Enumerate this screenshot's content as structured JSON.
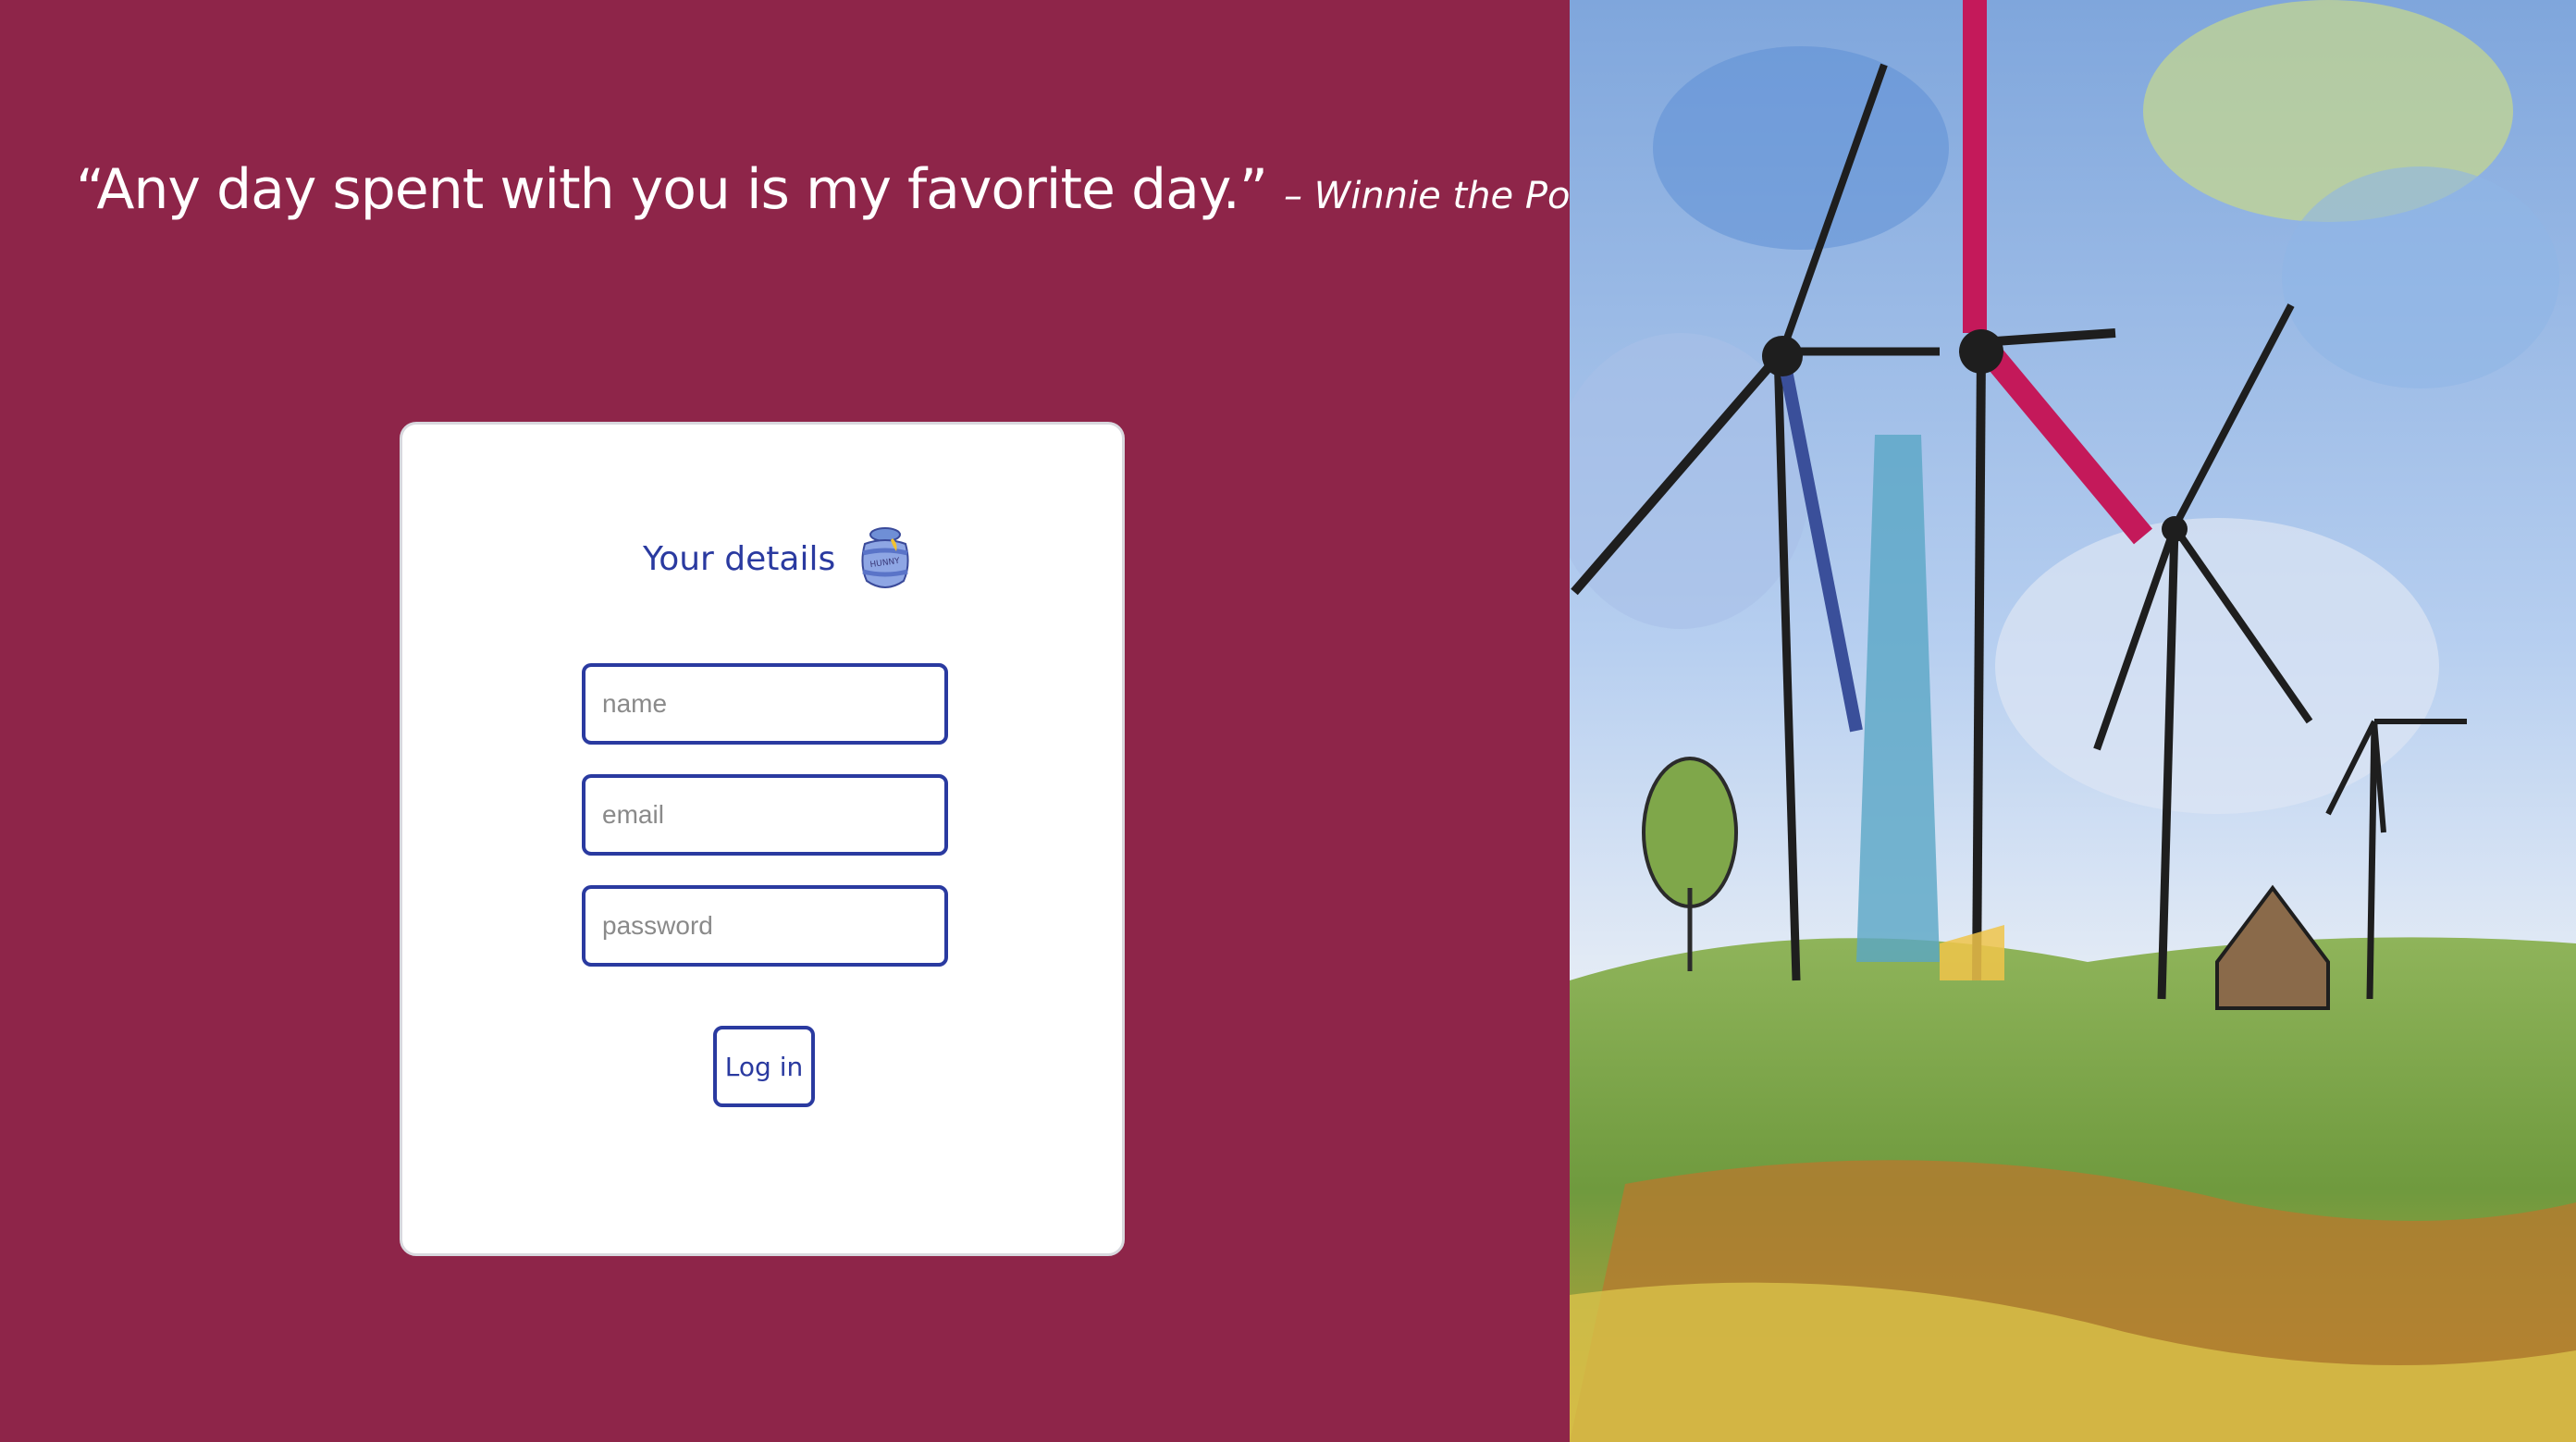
{
  "quote": {
    "text": "“Any day spent with you is my favorite day.”",
    "author": "– Winnie the Pooh"
  },
  "form": {
    "title": "Your details",
    "icon": "honey-pot-icon",
    "icon_label": "HUNNY",
    "name_placeholder": "name",
    "email_placeholder": "email",
    "password_placeholder": "password",
    "login_label": "Log in"
  },
  "colors": {
    "background": "#8e2549",
    "accent": "#2a3aa0",
    "card": "#ffffff"
  },
  "image": {
    "subject": "watercolor-windmills-illustration"
  }
}
